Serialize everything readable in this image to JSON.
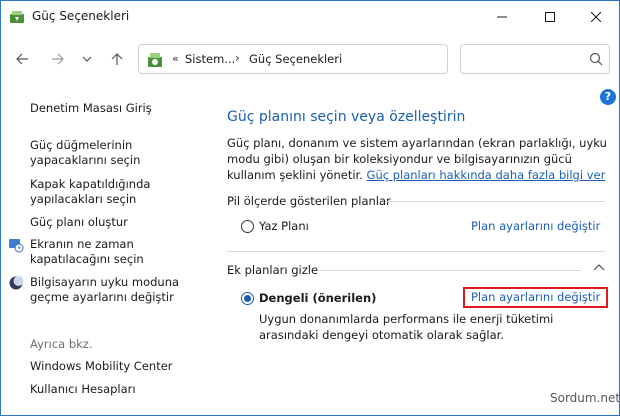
{
  "window": {
    "title": "Güç Seçenekleri"
  },
  "nav": {
    "breadcrumb_chevron": "«",
    "segment1": "Sistem...",
    "separator": "›",
    "segment2": "Güç Seçenekleri",
    "search_placeholder": ""
  },
  "sidebar": {
    "items": [
      {
        "label": "Denetim Masası Giriş"
      },
      {
        "label": "Güç düğmelerinin yapacaklarını seçin"
      },
      {
        "label": "Kapak kapatıldığında yapılacakları seçin"
      },
      {
        "label": "Güç planı oluştur"
      },
      {
        "label": "Ekranın ne zaman kapatılacağını seçin"
      },
      {
        "label": "Bilgisayarın uyku moduna geçme ayarlarını değiştir"
      }
    ],
    "see_also": "Ayrıca bkz.",
    "see_also_items": [
      {
        "label": "Windows Mobility Center"
      },
      {
        "label": "Kullanıcı Hesapları"
      }
    ]
  },
  "main": {
    "help": "?",
    "title": "Güç planını seçin veya özelleştirin",
    "description": "Güç planı, donanım ve sistem ayarlarından (ekran parlaklığı, uyku modu gibi) oluşan bir koleksiyondur ve bilgisayarınızın gücü kullanım şeklini yönetir. ",
    "learn_more": "Güç planları hakkında daha fazla bilgi ver",
    "battery_section": "Pil ölçerde gösterilen planlar",
    "additional_section": "Ek planları gizle",
    "plans": [
      {
        "name": "Yaz Planı",
        "link": "Plan ayarlarını değiştir",
        "selected": false
      },
      {
        "name": "Dengeli (önerilen)",
        "link": "Plan ayarlarını değiştir",
        "selected": true,
        "description": "Uygun donanımlarda performans ile enerji tüketimi arasındaki dengeyi otomatik olarak sağlar."
      }
    ]
  },
  "watermark": "Sordum.net",
  "colors": {
    "link": "#1a5fb4",
    "title": "#1a5fb4",
    "highlight_box": "#e0191e",
    "help_icon": "#1e73d6"
  }
}
